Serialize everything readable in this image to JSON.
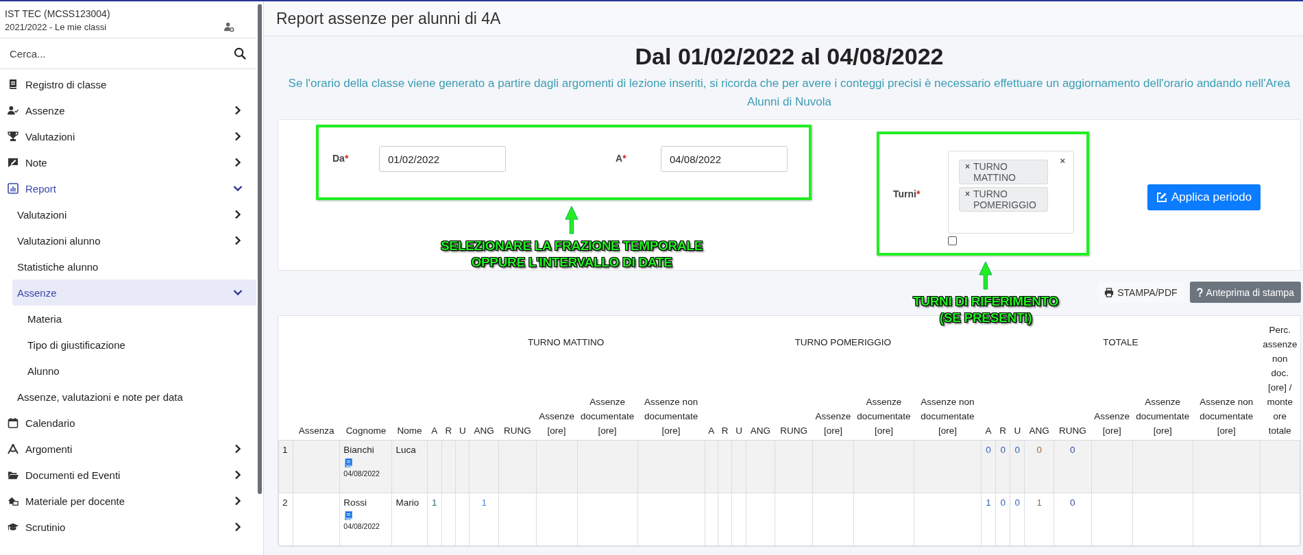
{
  "sidebar": {
    "school": "IST TEC (MCSS123004)",
    "year": "2021/2022 - Le mie classi",
    "search": {
      "placeholder": "Cerca..."
    },
    "items": [
      {
        "label": "Registro di classe",
        "selected": false
      },
      {
        "label": "Assenze",
        "selected": false,
        "expanded": false
      },
      {
        "label": "Valutazioni",
        "selected": false,
        "expanded": false
      },
      {
        "label": "Note",
        "selected": false,
        "expanded": false
      },
      {
        "label": "Report",
        "selected": false,
        "expanded": true,
        "children": [
          {
            "label": "Valutazioni",
            "selected": false,
            "expanded": false
          },
          {
            "label": "Valutazioni alunno",
            "selected": false,
            "expanded": false
          },
          {
            "label": "Statistiche alunno",
            "selected": false
          },
          {
            "label": "Assenze",
            "selected": true,
            "expanded": true,
            "children": [
              {
                "label": "Materia",
                "selected": false
              },
              {
                "label": "Tipo di giustificazione",
                "selected": false
              },
              {
                "label": "Alunno",
                "selected": false
              }
            ]
          },
          {
            "label": "Assenze, valutazioni e note per data",
            "selected": false
          }
        ]
      },
      {
        "label": "Calendario",
        "selected": false
      },
      {
        "label": "Argomenti",
        "selected": false,
        "expanded": false
      },
      {
        "label": "Documenti ed Eventi",
        "selected": false,
        "expanded": false
      },
      {
        "label": "Materiale per docente",
        "selected": false,
        "expanded": false
      },
      {
        "label": "Scrutinio",
        "selected": false,
        "expanded": false
      }
    ]
  },
  "page_title": "Report assenze per alunni di 4A",
  "period_heading": "Dal 01/02/2022 al 04/08/2022",
  "notice": "Se l'orario della classe viene generato a partire dagli argomenti di lezione inseriti, si ricorda che per avere i conteggi precisi è necessario effettuare un aggiornamento dell'orario andando nell'Area Alunni di Nuvola",
  "form": {
    "from": {
      "label": "Da",
      "required_mark": "*",
      "value": "01/02/2022"
    },
    "to": {
      "label": "A",
      "required_mark": "*",
      "value": "04/08/2022"
    },
    "turni": {
      "label": "Turni",
      "required_mark": "*",
      "chip_remove": "×",
      "clear": "×",
      "checked": false,
      "chips": [
        {
          "label": "TURNO MATTINO"
        },
        {
          "label": "TURNO POMERIGGIO"
        }
      ]
    },
    "apply_button": "Applica periodo"
  },
  "print_buttons": [
    {
      "label": "STAMPA/PDF",
      "kind": "print"
    },
    {
      "label": "Anteprima di stampa",
      "kind": "preview"
    }
  ],
  "table": {
    "lead_columns": [
      "Assenza",
      "Cognome",
      "Nome"
    ],
    "groups": [
      {
        "label": "TURNO MATTINO",
        "columns": [
          "A",
          "R",
          "U",
          "ANG",
          "RUNG",
          "Assenze [ore]",
          "Assenze documentate [ore]",
          "Assenze non documentate [ore]"
        ]
      },
      {
        "label": "TURNO POMERIGGIO",
        "columns": [
          "A",
          "R",
          "U",
          "ANG",
          "RUNG",
          "Assenze [ore]",
          "Assenze documentate [ore]",
          "Assenze non documentate [ore]"
        ]
      },
      {
        "label": "TOTALE",
        "columns": [
          "A",
          "R",
          "U",
          "ANG",
          "RUNG",
          "Assenze [ore]",
          "Assenze documentate [ore]",
          "Assenze non documentate [ore]"
        ]
      }
    ],
    "last_column": "Perc. assenze non doc. [ore] / monte ore totale",
    "rows": [
      {
        "number": "1",
        "cognome": "Bianchi",
        "date": "04/08/2022",
        "nome": "Luca",
        "totale": {
          "a": "0",
          "r": "0",
          "u": "0",
          "ang": "0",
          "rung": "0"
        }
      },
      {
        "number": "2",
        "cognome": "Rossi",
        "date": "04/08/2022",
        "nome": "Mario",
        "mattino": {
          "a": "1",
          "ang": "1"
        },
        "totale": {
          "a": "1",
          "r": "0",
          "u": "0",
          "ang": "1",
          "rung": "0"
        }
      }
    ]
  },
  "annotations": [
    {
      "lines": [
        "SELEZIONARE LA FRAZIONE TEMPORALE",
        "OPPURE L'INTERVALLO DI DATE"
      ]
    },
    {
      "lines": [
        "TURNI DI RIFERIMENTO",
        "(SE PRESENTI)"
      ]
    }
  ]
}
